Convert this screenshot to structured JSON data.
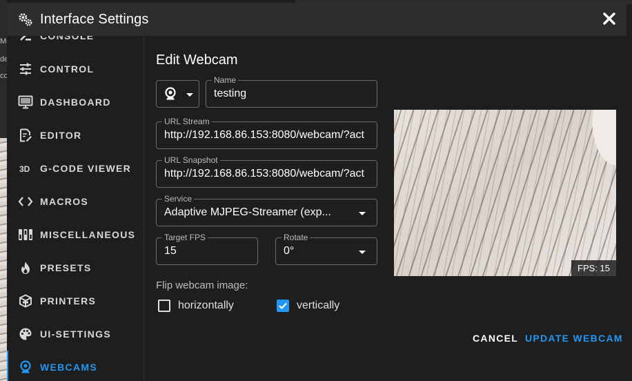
{
  "window": {
    "title": "Interface Settings"
  },
  "background": {
    "snippets": [
      "Mo",
      "de",
      "cc"
    ]
  },
  "sidebar": {
    "items": [
      {
        "label": "CONSOLE",
        "icon": "console-icon"
      },
      {
        "label": "CONTROL",
        "icon": "sliders-icon"
      },
      {
        "label": "DASHBOARD",
        "icon": "monitor-icon"
      },
      {
        "label": "EDITOR",
        "icon": "file-edit-icon"
      },
      {
        "label": "G-CODE VIEWER",
        "icon": "3d-icon"
      },
      {
        "label": "MACROS",
        "icon": "code-brackets-icon"
      },
      {
        "label": "MISCELLANEOUS",
        "icon": "dip-switch-icon"
      },
      {
        "label": "PRESETS",
        "icon": "fire-icon"
      },
      {
        "label": "PRINTERS",
        "icon": "printer-3d-icon"
      },
      {
        "label": "UI-SETTINGS",
        "icon": "palette-icon"
      },
      {
        "label": "WEBCAMS",
        "icon": "webcam-icon",
        "active": true
      }
    ]
  },
  "form": {
    "heading": "Edit Webcam",
    "name": {
      "label": "Name",
      "value": "testing"
    },
    "url_stream": {
      "label": "URL Stream",
      "value": "http://192.168.86.153:8080/webcam/?act"
    },
    "url_snapshot": {
      "label": "URL Snapshot",
      "value": "http://192.168.86.153:8080/webcam/?act"
    },
    "service": {
      "label": "Service",
      "value": "Adaptive MJPEG-Streamer (exp..."
    },
    "target_fps": {
      "label": "Target FPS",
      "value": "15"
    },
    "rotate": {
      "label": "Rotate",
      "value": "0°"
    },
    "flip_label": "Flip webcam image:",
    "flip_horizontal": {
      "label": "horizontally",
      "checked": false
    },
    "flip_vertical": {
      "label": "vertically",
      "checked": true
    }
  },
  "preview": {
    "fps_text": "FPS: 15"
  },
  "actions": {
    "cancel": "CANCEL",
    "update": "UPDATE WEBCAM"
  },
  "colors": {
    "accent": "#2196f3",
    "surface": "#1e1e1e",
    "titlebar": "#2d2d2d"
  }
}
